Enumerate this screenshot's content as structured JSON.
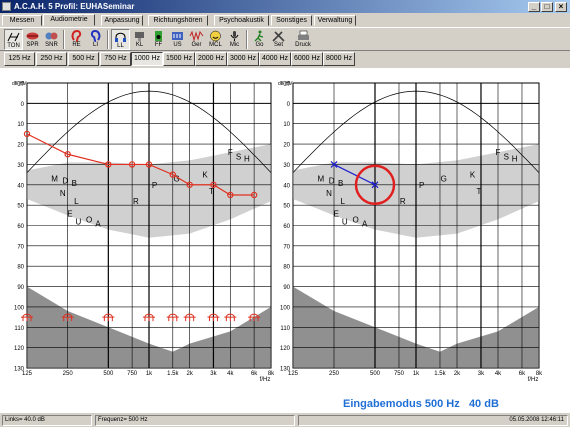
{
  "window": {
    "title": "A.C.A.H. 5  Profil: EUHASeminar",
    "min": "_",
    "max": "□",
    "close": "×"
  },
  "tabs": [
    "Messen",
    "Audiometrie",
    "Anpassung",
    "Richtungshören",
    "Psychoakustik",
    "Sonstiges",
    "Verwaltung"
  ],
  "toolbar": [
    {
      "label": "TON",
      "icon": "tone-icon"
    },
    {
      "label": "SPR",
      "icon": "speech-lips-icon"
    },
    {
      "label": "SNR",
      "icon": "snr-heads-icon"
    },
    {
      "label": "RE",
      "icon": "right-ear-icon"
    },
    {
      "label": "LI",
      "icon": "left-ear-icon"
    },
    {
      "label": "LL",
      "icon": "headphones-icon"
    },
    {
      "label": "KL",
      "icon": "bone-conductor-icon"
    },
    {
      "label": "FF",
      "icon": "free-field-icon"
    },
    {
      "label": "US",
      "icon": "uncomfortable-level-icon"
    },
    {
      "label": "Ger",
      "icon": "noise-icon"
    },
    {
      "label": "MCL",
      "icon": "smiley-icon"
    },
    {
      "label": "Mic",
      "icon": "microphone-icon"
    },
    {
      "label": "Go",
      "icon": "run-icon"
    },
    {
      "label": "Set",
      "icon": "tools-icon"
    },
    {
      "label": "Druck",
      "icon": "printer-icon"
    }
  ],
  "freq_buttons": [
    "125 Hz",
    "250 Hz",
    "500 Hz",
    "750 Hz",
    "1000 Hz",
    "1500 Hz",
    "2000 Hz",
    "3000 Hz",
    "4000 Hz",
    "6000 Hz",
    "8000 Hz"
  ],
  "freq_selected": "1000 Hz",
  "axis": {
    "y_unit": "dB HV",
    "y_ticks": [
      "-10",
      "0",
      "10",
      "20",
      "30",
      "40",
      "50",
      "60",
      "70",
      "80",
      "90",
      "100",
      "110",
      "120",
      "130"
    ],
    "x_ticks": [
      "125",
      "250",
      "500",
      "750",
      "1k",
      "1.5k",
      "2k",
      "3k",
      "4k",
      "6k",
      "8k"
    ],
    "x_unit": "f/Hz"
  },
  "speech_letters": [
    "M",
    "D",
    "B",
    "N",
    "L",
    "E",
    "U",
    "O",
    "A",
    "R",
    "P",
    "G",
    "K",
    "T",
    "F",
    "S",
    "H"
  ],
  "chart_data": {
    "type": "line",
    "x": [
      125,
      250,
      500,
      750,
      1000,
      1500,
      2000,
      3000,
      4000,
      6000
    ],
    "series": [
      {
        "color": "#e03020",
        "values": [
          15,
          25,
          30,
          30,
          30,
          35,
          40,
          40,
          45,
          45
        ]
      }
    ],
    "ylim": [
      -10,
      130
    ],
    "right_panel": {
      "line_color": "#2020d0",
      "points": [
        [
          250,
          30
        ],
        [
          500,
          40
        ]
      ],
      "circle_center": [
        500,
        40
      ]
    }
  },
  "mode": {
    "label": "Eingabemodus 500 Hz",
    "value": "40 dB"
  },
  "status": {
    "links": "Links= 40.0 dB",
    "frequenz": "Frequenz= 500 Hz",
    "datetime": "05.05.2008 12:46:11"
  }
}
